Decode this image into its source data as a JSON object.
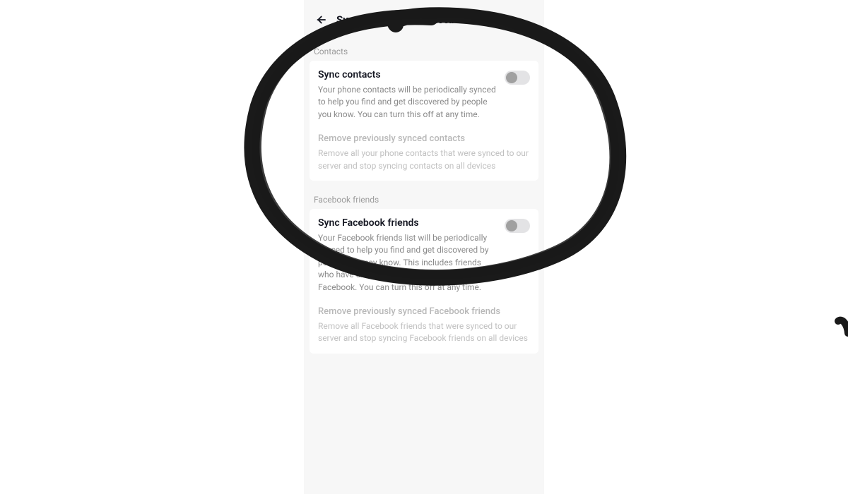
{
  "header": {
    "title": "Sync contacts and Facebook friends"
  },
  "sections": {
    "contacts": {
      "label": "Contacts",
      "sync_title": "Sync contacts",
      "sync_desc": "Your phone contacts will be periodically synced to help you find and get discovered by people you know. You can turn this off at any time.",
      "remove_title": "Remove previously synced contacts",
      "remove_desc": "Remove all your phone contacts that were synced to our server and stop syncing contacts on all devices",
      "toggle_on": false
    },
    "facebook": {
      "label": "Facebook friends",
      "sync_title": "Sync Facebook friends",
      "sync_desc": "Your Facebook friends list will be periodically synced to help you find and get discovered by people you may know. This includes friends who have direct connections with you on Facebook. You can turn this off at any time.",
      "remove_title": "Remove previously synced Facebook friends",
      "remove_desc": "Remove all Facebook friends that were synced to our server and stop syncing Facebook friends on all devices",
      "toggle_on": false
    }
  }
}
